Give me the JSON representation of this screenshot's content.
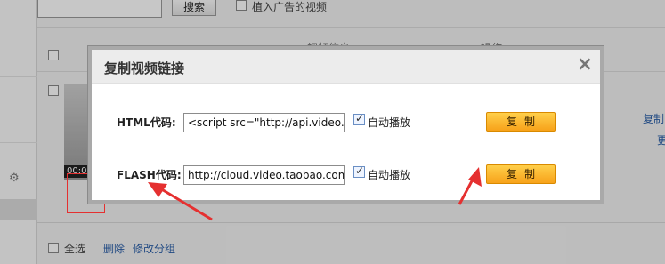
{
  "toolbar": {
    "search_button": "搜索",
    "ad_label": "植入广告的视频"
  },
  "table": {
    "header_col1": "视频信息",
    "header_col2": "操作",
    "video_time": "00:0",
    "right_link1": "复制",
    "right_link2": "更"
  },
  "footer": {
    "select_all": "全选",
    "delete": "删除",
    "edit_group": "修改分组"
  },
  "dialog": {
    "title": "复制视频链接",
    "close_icon": "×",
    "html_label": "HTML代码:",
    "html_code": "<script src=\"http://api.video.taobao.com/",
    "flash_label": "FLASH代码:",
    "flash_code": "http://cloud.video.taobao.com/play",
    "autoplay_label": "自动播放",
    "copy_label": "复制"
  },
  "colors": {
    "copy_button": "#f7a21a",
    "annotation": "#e53030",
    "link": "#2b5fa8"
  }
}
